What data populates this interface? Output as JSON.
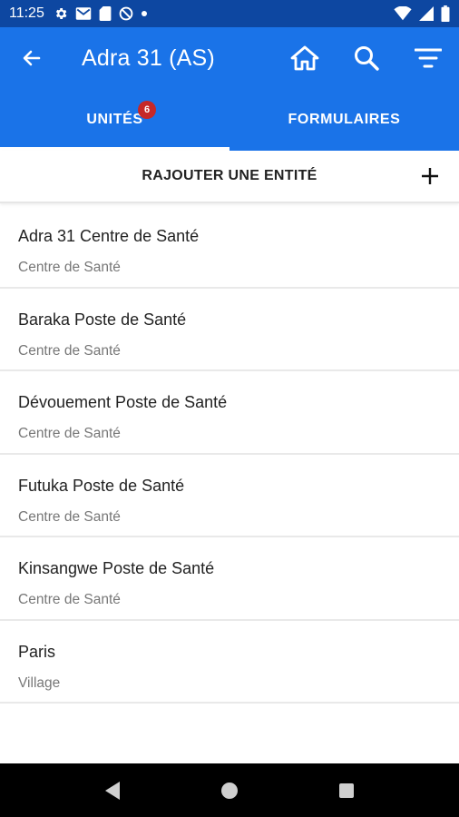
{
  "status_bar": {
    "time": "11:25",
    "left_icons": [
      "gear-icon",
      "gmail-icon",
      "sd-card-icon",
      "no-sim-icon",
      "dot-icon"
    ],
    "right_icons": [
      "wifi-icon",
      "signal-icon",
      "battery-icon"
    ]
  },
  "app_bar": {
    "title": "Adra 31 (AS)",
    "back_icon": "arrow-left-icon",
    "actions": [
      "home-icon",
      "search-icon",
      "filter-icon"
    ]
  },
  "tabs": [
    {
      "label": "UNITÉS",
      "badge": "6",
      "active": true
    },
    {
      "label": "FORMULAIRES",
      "active": false
    }
  ],
  "add_entity": {
    "label": "RAJOUTER UNE ENTITÉ",
    "icon": "plus-icon"
  },
  "entities": [
    {
      "name": "Adra 31 Centre de Santé",
      "type": "Centre de Santé"
    },
    {
      "name": "Baraka Poste de Santé",
      "type": "Centre de Santé"
    },
    {
      "name": "Dévouement Poste de Santé",
      "type": "Centre de Santé"
    },
    {
      "name": "Futuka Poste de Santé",
      "type": "Centre de Santé"
    },
    {
      "name": "Kinsangwe Poste de Santé",
      "type": "Centre de Santé"
    },
    {
      "name": "Paris",
      "type": "Village"
    }
  ],
  "colors": {
    "status_bar": "#0d47a1",
    "primary": "#1a73e8",
    "badge": "#c62828"
  }
}
